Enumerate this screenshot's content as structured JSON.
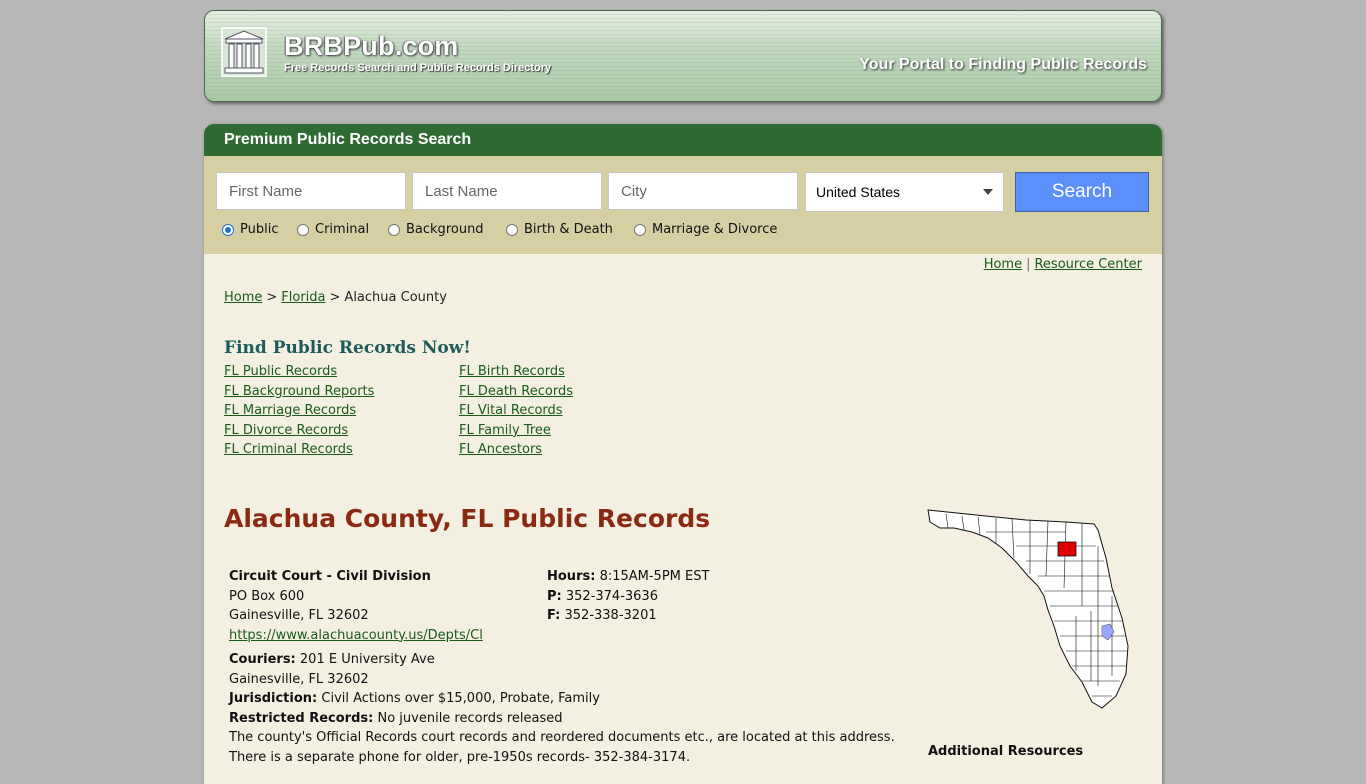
{
  "header": {
    "site_name": "BRBPub.com",
    "tagline": "Free Records Search and Public Records Directory",
    "slogan": "Your Portal to Finding Public Records"
  },
  "search": {
    "title": "Premium Public Records Search",
    "first_name_placeholder": "First Name",
    "last_name_placeholder": "Last Name",
    "city_placeholder": "City",
    "country_selected": "United States",
    "button_label": "Search",
    "record_types": [
      {
        "label": "Public",
        "checked": true
      },
      {
        "label": "Criminal",
        "checked": false
      },
      {
        "label": "Background",
        "checked": false
      },
      {
        "label": "Birth & Death",
        "checked": false
      },
      {
        "label": "Marriage & Divorce",
        "checked": false
      }
    ]
  },
  "top_links": {
    "home": "Home",
    "separator": "|",
    "resource_center": "Resource Center"
  },
  "breadcrumb": {
    "home": "Home",
    "sep": ">",
    "state": "Florida",
    "current": "Alachua County"
  },
  "find_records": {
    "title": "Find Public Records Now!",
    "left_links": [
      "FL Public Records",
      "FL Background Reports",
      "FL Marriage Records",
      "FL Divorce Records",
      "FL Criminal Records"
    ],
    "right_links": [
      "FL Birth Records",
      "FL Death Records",
      "FL Vital Records",
      "FL Family Tree",
      "FL Ancestors"
    ]
  },
  "county": {
    "title": "Alachua County, FL Public Records",
    "office_name": "Circuit Court - Civil Division",
    "address_line1": "PO Box 600",
    "address_line2": "Gainesville, FL 32602",
    "website": "https://www.alachuacounty.us/Depts/Cl",
    "hours_label": "Hours:",
    "hours_value": "8:15AM-5PM EST",
    "phone_label": "P:",
    "phone_value": "352-374-3636",
    "fax_label": "F:",
    "fax_value": "352-338-3201",
    "couriers_label": "Couriers:",
    "couriers_value": "201 E University Ave",
    "couriers_city": "Gainesville, FL 32602",
    "jurisdiction_label": "Jurisdiction:",
    "jurisdiction_value": "Civil Actions over $15,000, Probate, Family",
    "restricted_label": "Restricted Records:",
    "restricted_value": "No juvenile records released",
    "note_line1": "The county's Official Records court records and reordered documents etc., are located at this address.",
    "note_line2": "There is a separate phone for older, pre-1950s records- 352-384-3174."
  },
  "sidebar": {
    "additional_title": "Additional Resources"
  },
  "colors": {
    "header_green": "#2f6a33",
    "search_band": "#d6cfa4",
    "panel_bg": "#f3efe1",
    "title_red": "#8b2a12",
    "button_blue": "#5b8ff9",
    "highlight_county": "#e00000"
  },
  "icons": {
    "logo": "building-columns-icon",
    "dropdown": "chevron-down-icon",
    "map": "florida-county-map"
  }
}
